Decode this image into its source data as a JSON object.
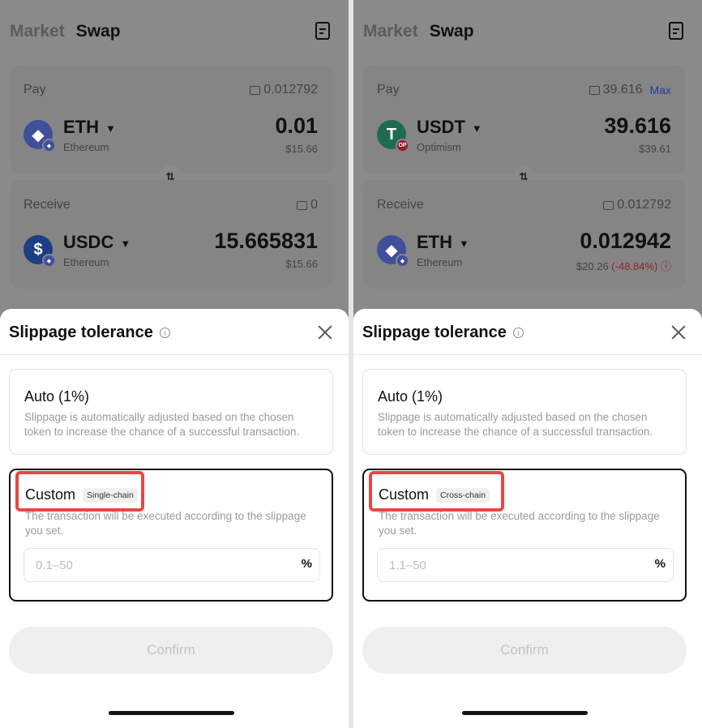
{
  "panels": [
    {
      "nav": {
        "market": "Market",
        "swap": "Swap"
      },
      "pay": {
        "label": "Pay",
        "balance": "0.012792",
        "max": "",
        "token": "ETH",
        "chain": "Ethereum",
        "amount": "0.01",
        "usd": "$15.66",
        "usd_change": "",
        "icon_color": "#3f4f9a",
        "icon_glyph": "◆",
        "badge_color": "#3f4f9a",
        "badge_text": ""
      },
      "receive": {
        "label": "Receive",
        "balance": "0",
        "token": "USDC",
        "chain": "Ethereum",
        "amount": "15.665831",
        "usd": "$15.66",
        "usd_change": "",
        "icon_color": "#1b3f82",
        "icon_glyph": "$",
        "badge_color": "#3f4f9a",
        "badge_text": ""
      },
      "sheet": {
        "title": "Slippage tolerance",
        "auto_title": "Auto (1%)",
        "auto_desc": "Slippage is automatically adjusted based on the chosen token to increase the chance of a successful transaction.",
        "custom_title": "Custom",
        "custom_tag": "Single-chain",
        "custom_desc": "The transaction will be executed according to the slippage you set.",
        "input_placeholder": "0.1–50",
        "percent": "%",
        "confirm": "Confirm"
      }
    },
    {
      "nav": {
        "market": "Market",
        "swap": "Swap"
      },
      "pay": {
        "label": "Pay",
        "balance": "39.616",
        "max": "Max",
        "token": "USDT",
        "chain": "Optimism",
        "amount": "39.616",
        "usd": "$39.61",
        "usd_change": "",
        "icon_color": "#1e6b53",
        "icon_glyph": "T",
        "badge_color": "#8e1f24",
        "badge_text": "OP"
      },
      "receive": {
        "label": "Receive",
        "balance": "0.012792",
        "token": "ETH",
        "chain": "Ethereum",
        "amount": "0.012942",
        "usd": "$20.26",
        "usd_change": " (-48.84%) ⓘ",
        "icon_color": "#3f4f9a",
        "icon_glyph": "◆",
        "badge_color": "#3f4f9a",
        "badge_text": ""
      },
      "sheet": {
        "title": "Slippage tolerance",
        "auto_title": "Auto (1%)",
        "auto_desc": "Slippage is automatically adjusted based on the chosen token to increase the chance of a successful transaction.",
        "custom_title": "Custom",
        "custom_tag": "Cross-chain",
        "custom_desc": "The transaction will be executed according to the slippage you set.",
        "input_placeholder": "1.1–50",
        "percent": "%",
        "confirm": "Confirm"
      }
    }
  ]
}
